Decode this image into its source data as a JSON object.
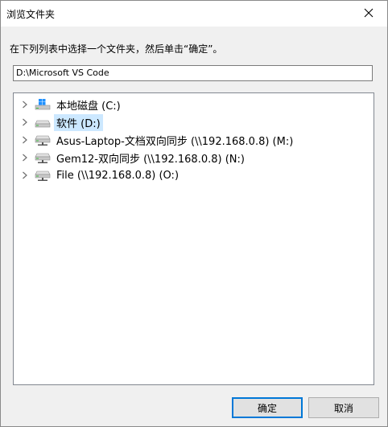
{
  "window": {
    "title": "浏览文件夹"
  },
  "instruction": "在下列列表中选择一个文件夹，然后单击“确定”。",
  "path": {
    "value": "D:\\Microsoft VS Code"
  },
  "tree": {
    "items": [
      {
        "label": "本地磁盘 (C:)",
        "icon": "windows-drive-icon",
        "selected": false
      },
      {
        "label": "软件 (D:)",
        "icon": "drive-icon",
        "selected": true
      },
      {
        "label": "Asus-Laptop-文档双向同步 (\\\\192.168.0.8) (M:)",
        "icon": "network-drive-icon",
        "selected": false
      },
      {
        "label": "Gem12-双向同步 (\\\\192.168.0.8) (N:)",
        "icon": "network-drive-icon",
        "selected": false
      },
      {
        "label": "File (\\\\192.168.0.8) (O:)",
        "icon": "network-drive-icon",
        "selected": false
      }
    ]
  },
  "buttons": {
    "ok": "确定",
    "cancel": "取消"
  },
  "colors": {
    "selection": "#cce8ff",
    "accent": "#0078d7",
    "windows_logo": "#1e90ff"
  }
}
